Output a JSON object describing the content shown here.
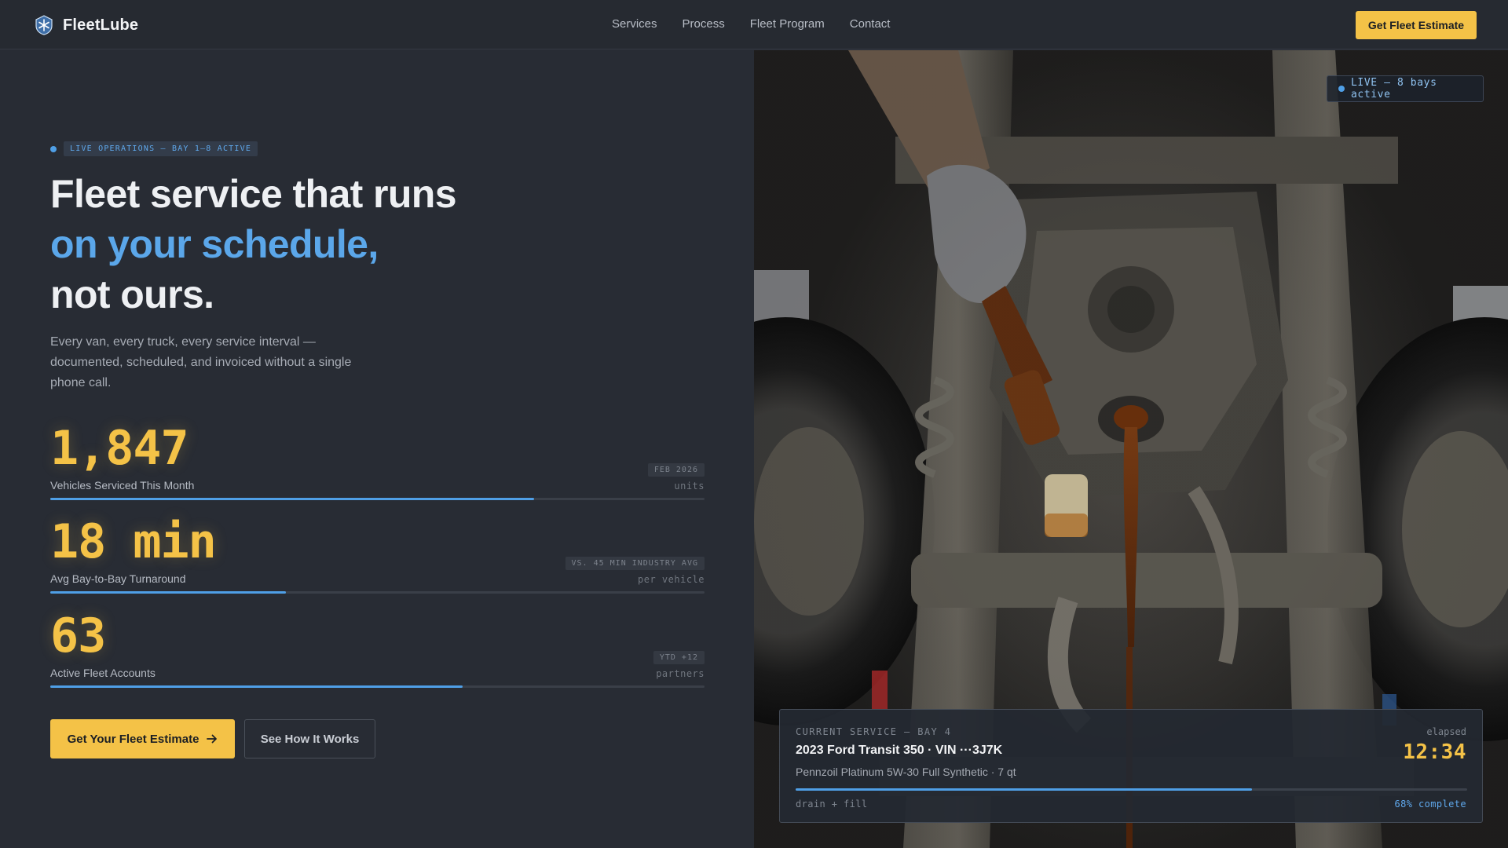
{
  "brand": {
    "name": "FleetLube",
    "logo_icon": "snowflake-shield-icon"
  },
  "nav": {
    "links": [
      "Services",
      "Process",
      "Fleet Program",
      "Contact"
    ],
    "cta_label": "Get Fleet Estimate"
  },
  "hero": {
    "live_label": "LIVE OPERATIONS — BAY 1–8 ACTIVE",
    "headline": [
      "Fleet service that runs",
      "on your schedule,",
      "not ours."
    ],
    "subcopy": "Every van, every truck, every service interval — documented, scheduled, and invoiced without a single phone call."
  },
  "stats": [
    {
      "value": "1,847",
      "label": "Vehicles Serviced This Month",
      "badge": "FEB 2026",
      "unit": "units",
      "progress": 0.74
    },
    {
      "value": "18 min",
      "label": "Avg Bay-to-Bay Turnaround",
      "badge": "VS. 45 MIN INDUSTRY AVG",
      "unit": "per vehicle",
      "progress": 0.36
    },
    {
      "value": "63",
      "label": "Active Fleet Accounts",
      "badge": "YTD +12",
      "unit": "partners",
      "progress": 0.63
    }
  ],
  "actions": {
    "primary_label": "Get Your Fleet Estimate",
    "primary_icon": "arrow-right-icon",
    "secondary_label": "See How It Works"
  },
  "photo_panel": {
    "live_pill": "LIVE — 8 bays active"
  },
  "current_service": {
    "kicker": "CURRENT SERVICE — BAY 4",
    "vehicle": "2023 Ford Transit 350 · VIN ···3J7K",
    "details": "Pennzoil Platinum 5W-30 Full Synthetic · 7 qt",
    "elapsed_label": "elapsed",
    "elapsed": "12:34",
    "step": "drain + fill",
    "percent_label": "68% complete",
    "progress": 0.68
  },
  "colors": {
    "accent_yellow": "#f4c247",
    "accent_blue": "#5ba7ea",
    "background": "#282c34"
  }
}
